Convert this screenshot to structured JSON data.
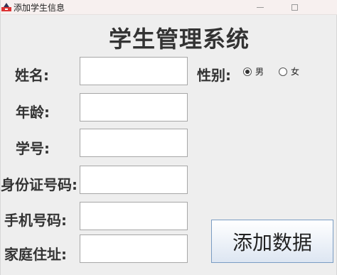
{
  "window": {
    "title": "添加学生信息"
  },
  "header": {
    "title": "学生管理系统"
  },
  "form": {
    "name_label": "姓名:",
    "age_label": "年龄:",
    "student_id_label": "学号:",
    "id_card_label": "身份证号码:",
    "phone_label": "手机号码:",
    "address_label": "家庭住址:",
    "gender_label": "性别:",
    "gender_options": [
      "男",
      "女"
    ],
    "gender_selected": "男",
    "name_value": "",
    "age_value": "",
    "student_id_value": "",
    "id_card_value": "",
    "phone_value": "",
    "address_value": "",
    "submit_label": "添加数据"
  },
  "icons": {
    "app": "java-app-icon",
    "minimize": "minimize-icon",
    "maximize": "maximize-icon"
  }
}
